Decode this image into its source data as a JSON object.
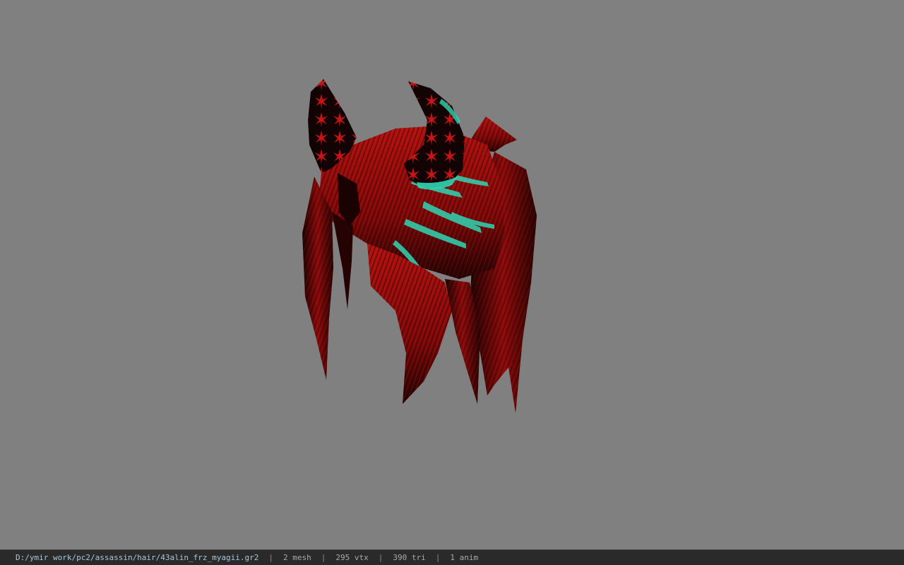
{
  "viewer": {
    "background_color": "#808080",
    "model": {
      "name": "hair-with-horns-model",
      "hair_color": "#a00a0a",
      "highlight_color": "#2fd6b4",
      "horn_pattern_color": "#c81414"
    }
  },
  "status_bar": {
    "file_path": "D:/ymir work/pc2/assassin/hair/43alin_frz_myagii.gr2",
    "separator": "|",
    "mesh_count": "2 mesh",
    "vertex_count": "295 vtx",
    "triangle_count": "390 tri",
    "anim_count": "1 anim"
  }
}
